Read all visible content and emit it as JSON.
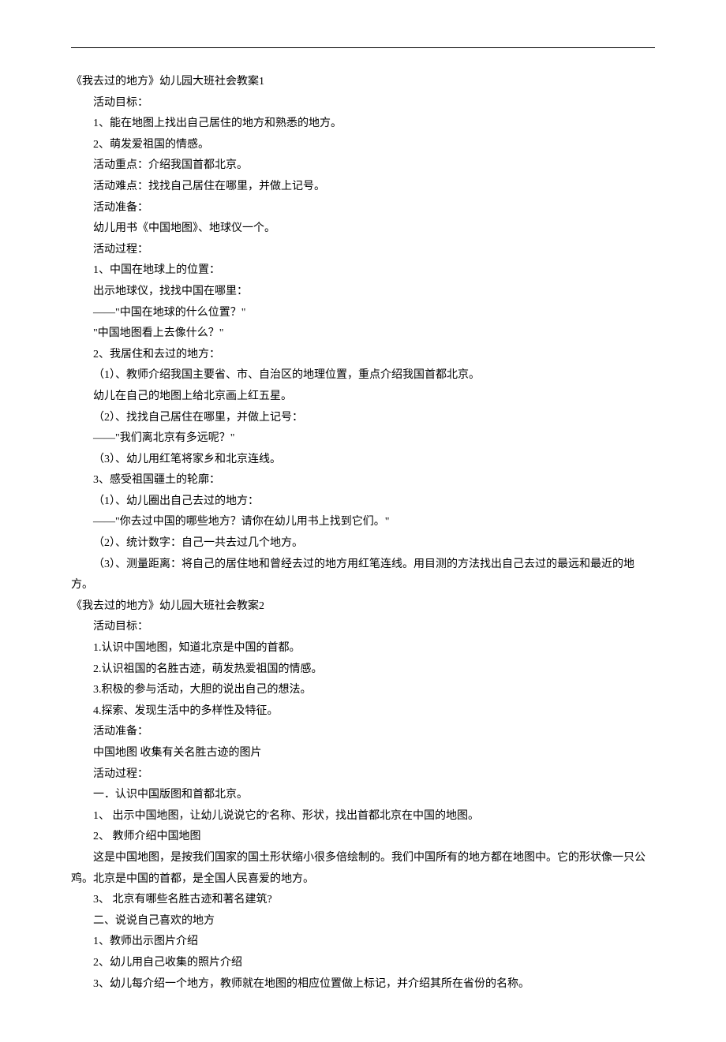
{
  "sections": [
    {
      "title": "《我去过的地方》幼儿园大班社会教案1",
      "lines": [
        "活动目标：",
        "1、能在地图上找出自己居住的地方和熟悉的地方。",
        "2、萌发爱祖国的情感。",
        "活动重点：介绍我国首都北京。",
        "活动难点：找找自己居住在哪里，并做上记号。",
        "活动准备：",
        "幼儿用书《中国地图》、地球仪一个。",
        "活动过程：",
        "1、中国在地球上的位置：",
        "出示地球仪，找找中国在哪里：",
        "——\"中国在地球的什么位置？\"",
        "\"中国地图看上去像什么？\"",
        "2、我居住和去过的地方：",
        "（1）、教师介绍我国主要省、市、自治区的地理位置，重点介绍我国首都北京。",
        "幼儿在自己的地图上给北京画上红五星。",
        "（2）、找找自己居住在哪里，并做上记号：",
        "——\"我们离北京有多远呢？\"",
        "（3）、幼儿用红笔将家乡和北京连线。",
        "3、感受祖国疆土的轮廓：",
        "（1）、幼儿圈出自己去过的地方：",
        "——\"你去过中国的哪些地方？请你在幼儿用书上找到它们。\"",
        "（2）、统计数字：自己一共去过几个地方。",
        "（3）、测量距离：将自己的居住地和曾经去过的地方用红笔连线。用目测的方法找出自己去过的最远和最近的地方。"
      ]
    },
    {
      "title": "《我去过的地方》幼儿园大班社会教案2",
      "lines": [
        "活动目标：",
        "1.认识中国地图，知道北京是中国的首都。",
        "2.认识祖国的名胜古迹，萌发热爱祖国的情感。",
        "3.积极的参与活动，大胆的说出自己的想法。",
        "4.探索、发现生活中的多样性及特征。",
        "活动准备：",
        "中国地图 收集有关名胜古迹的图片",
        "活动过程：",
        "一．认识中国版图和首都北京。",
        "1、 出示中国地图，让幼儿说说它的'名称、形状，找出首都北京在中国的地图。",
        "2、 教师介绍中国地图",
        "这是中国地图，是按我们国家的国土形状缩小很多倍绘制的。我们中国所有的地方都在地图中。它的形状像一只公鸡。北京是中国的首都，是全国人民喜爱的地方。",
        "3、 北京有哪些名胜古迹和著名建筑?",
        "二、说说自己喜欢的地方",
        "1、教师出示图片介绍",
        "2、幼儿用自己收集的照片介绍",
        "3、幼儿每介绍一个地方，教师就在地图的相应位置做上标记，并介绍其所在省份的名称。"
      ]
    }
  ]
}
